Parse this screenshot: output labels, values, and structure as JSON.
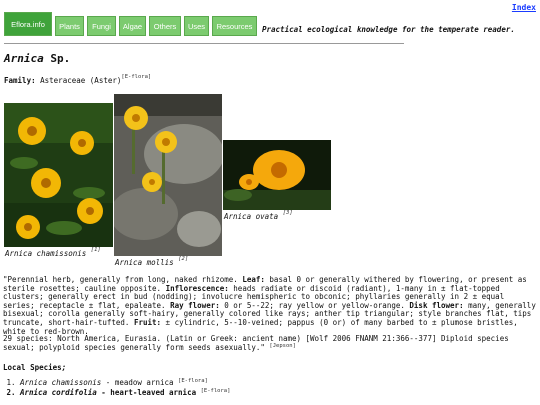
{
  "header": {
    "index_link": "Index",
    "nav": [
      {
        "label": "Eflora.info"
      },
      {
        "label": "Plants"
      },
      {
        "label": "Fungi"
      },
      {
        "label": "Algae"
      },
      {
        "label": "Others"
      },
      {
        "label": "Uses"
      },
      {
        "label": "Resources"
      }
    ],
    "tagline": "Practical ecological knowledge for the temperate reader."
  },
  "page": {
    "genus": "Arnica",
    "suffix": " Sp.",
    "family_label": "Family:",
    "family_value": " Asteraceae (Aster)",
    "family_ref": "[E-flora]"
  },
  "photos": [
    {
      "caption": "Arnica chamissonis",
      "ref": "[1]"
    },
    {
      "caption": "Arnica mollis",
      "ref": "[2]"
    },
    {
      "caption": "Arnica ovata",
      "ref": "[3]"
    }
  ],
  "description": {
    "p1_a": "\"Perennial herb, generally from long, naked rhizome. ",
    "leaf_label": "Leaf:",
    "p1_b": " basal 0 or generally withered by flowering, or present as sterile rosettes; cauline opposite. ",
    "infl_label": "Inflorescence:",
    "p1_c": " heads radiate or discoid (radiant), 1-many in ± flat-topped clusters; generally erect in bud (nodding); involucre hemispheric to obconic; phyllaries generally in 2 ± equal series; receptacle ± flat, epaleate. ",
    "ray_label": "Ray flower:",
    "p1_d": " 0 or 5--22; ray yellow or yellow-orange. ",
    "disk_label": "Disk flower:",
    "p1_e": " many, generally bisexual; corolla generally soft-hairy, generally colored like rays; anther tip triangular; style branches flat, tips truncate, short-hair-tufted. ",
    "fruit_label": "Fruit:",
    "p1_f": " ± cylindric, 5--10-veined; pappus (0 or) of many barbed to ± plumose bristles, white to red-brown.",
    "p2": "29 species: North America, Eurasia. (Latin or Greek: ancient name) [Wolf 2006 FNANM 21:366--377] Diploid species sexual; polyploid species generally form seeds asexually.\"",
    "p2_ref": "[Jepson]"
  },
  "local": {
    "title": "Local Species",
    "title_suffix": ";",
    "items": [
      {
        "name": "Arnica chamissonis",
        "common": " - meadow arnica ",
        "ref": "[E-flora]",
        "bold": false
      },
      {
        "name": "Arnica cordifolia",
        "common": " - heart-leaved arnica ",
        "ref": "[E-flora]",
        "bold": true
      }
    ]
  },
  "colors": {
    "nav_active": "#3fa33a",
    "nav_bg": "#7ccb6f",
    "link": "#1a3cff"
  }
}
